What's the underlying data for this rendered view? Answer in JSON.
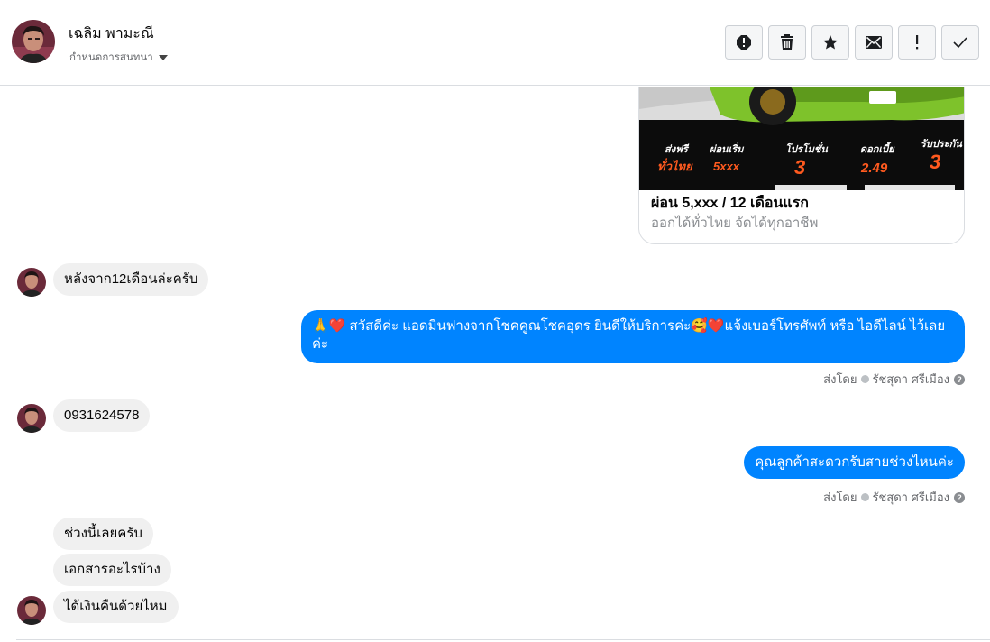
{
  "header": {
    "name": "เฉลิม พามะณี",
    "subtitle": "กำหนดการสนทนา",
    "toolbar": [
      "report-icon",
      "trash-icon",
      "star-icon",
      "envelope-icon",
      "exclamation-icon",
      "check-icon"
    ]
  },
  "card": {
    "image_labels": [
      {
        "top": "ส่งฟรี",
        "bottom": "ทั่วไทย"
      },
      {
        "top": "ผ่อนเริ่ม",
        "bottom": "5xxx"
      },
      {
        "top": "โปรโมชั่น",
        "bottom": "3"
      },
      {
        "top": "ดอกเบี้ย",
        "bottom": "2.49"
      },
      {
        "top": "รับประกัน",
        "bottom": "3"
      }
    ],
    "title": "ผ่อน 5,xxx / 12 เดือนแรก",
    "description": "ออกได้ทั่วไทย จัดได้ทุกอาชีพ"
  },
  "messages": {
    "m1": "หลังจาก12เดือนล่ะครับ",
    "m2": "🙏❤️ สวัสดีค่ะ แอดมินฟางจากโชคคูณโชคอุดร ยินดีให้บริการค่ะ🥰❤️แจ้งเบอร์โทรศัพท์ หรือ ไอดีไลน์  ไว้เลย",
    "m2b": "ค่ะ",
    "m3": "0931624578",
    "m4": "คุณลูกค้าสะดวกรับสายช่วงไหนค่ะ",
    "m5": "ช่วงนี้เลยครับ",
    "m6": "เอกสารอะไรบ้าง",
    "m7": "ได้เงินคืนด้วยไหม"
  },
  "sent_by": {
    "label": "ส่งโดย",
    "agent": "รัชสุดา ศรีเมือง"
  },
  "colors": {
    "outgoing": "#0084ff",
    "incoming": "#f0f0f0",
    "accent_orange": "#ff5a1f"
  }
}
